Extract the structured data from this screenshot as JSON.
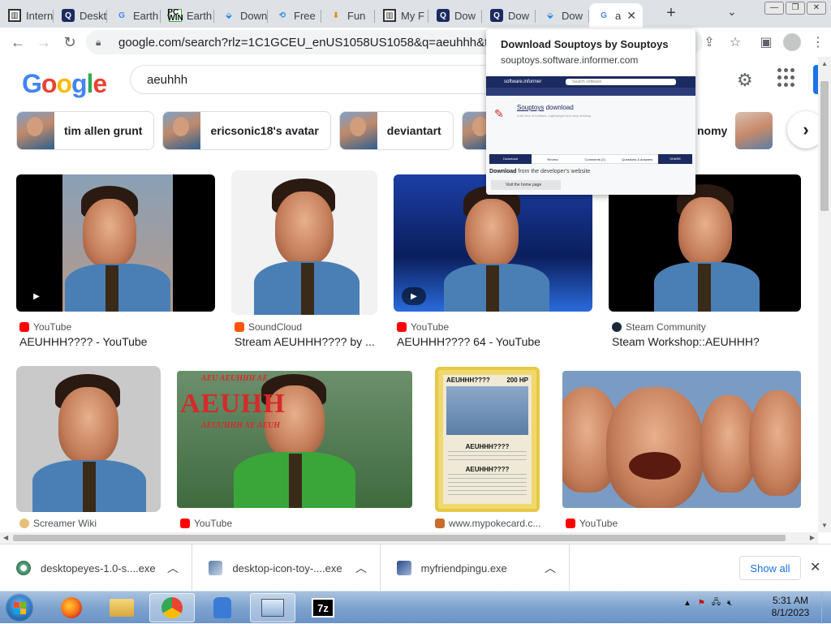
{
  "browser": {
    "tabs": [
      {
        "title": "Internet Archive",
        "icon": "bank-icon"
      },
      {
        "title": "Desktop",
        "icon": "informer-icon"
      },
      {
        "title": "Earth",
        "icon": "google-icon"
      },
      {
        "title": "Earth",
        "icon": "pcwin-icon"
      },
      {
        "title": "Download",
        "icon": "download-icon"
      },
      {
        "title": "Free",
        "icon": "refresh-icon"
      },
      {
        "title": "Fun",
        "icon": "download-arrow-icon"
      },
      {
        "title": "My F",
        "icon": "bank-icon"
      },
      {
        "title": "Dow",
        "icon": "informer-icon"
      },
      {
        "title": "Dow",
        "icon": "informer-icon"
      },
      {
        "title": "Dow",
        "icon": "download-icon"
      },
      {
        "title": "a",
        "icon": "google-icon",
        "active": true
      }
    ],
    "url": "google.com/search?rlz=1C1GCEU_enUS1058US1058&q=aeuhhh&tbm=isch"
  },
  "google": {
    "logo_letters": [
      "G",
      "o",
      "o",
      "g",
      "l",
      "e"
    ],
    "query": "aeuhhh"
  },
  "chips": [
    {
      "label": "tim allen grunt"
    },
    {
      "label": "ericsonic18's avatar"
    },
    {
      "label": "deviantart"
    }
  ],
  "chip_partial": "nomy",
  "results_row1": [
    {
      "source": "YouTube",
      "title": "AEUHHH???? - YouTube"
    },
    {
      "source": "SoundCloud",
      "title": "Stream AEUHHH???? by ..."
    },
    {
      "source": "YouTube",
      "title": "AEUHHH???? 64 - YouTube"
    },
    {
      "source": "Steam Community",
      "title": "Steam Workshop::AEUHHH?"
    }
  ],
  "results_row2": [
    {
      "source": "Screamer Wiki"
    },
    {
      "source": "YouTube"
    },
    {
      "source": "www.mypokecard.c..."
    },
    {
      "source": "YouTube"
    }
  ],
  "meme": {
    "line1": "AEU AEUHHH AE",
    "line2": "AEUHH",
    "line3": "AEUUHHH AE AEUH"
  },
  "pokecard": {
    "name": "AEUHHH????",
    "hp": "200 HP",
    "attack1": "AEUHHH????",
    "attack2": "AEUHHH????"
  },
  "popup": {
    "title": "Download Souptoys by Souptoys",
    "domain": "souptoys.software.informer.com",
    "site_logo": "software.informer",
    "search_placeholder": "Search software",
    "product_name": "Souptoys",
    "product_suffix": " download",
    "product_desc": "A lite free of toolbars. Lightweight and sexy desktop.",
    "tabs": [
      "Download",
      "Review",
      "Comments (2)",
      "Questions & Answers",
      "SHARE"
    ],
    "download_bold": "Download",
    "download_rest": " from the developer's website",
    "visit": "Visit the home page"
  },
  "downloads": [
    {
      "name": "desktopeyes-1.0-s....exe"
    },
    {
      "name": "desktop-icon-toy-....exe"
    },
    {
      "name": "myfriendpingu.exe"
    }
  ],
  "shelf": {
    "show_all": "Show all"
  },
  "taskbar": {
    "time": "5:31 AM",
    "date": "8/1/2023"
  },
  "colors": {
    "accent": "#1a73e8",
    "youtube": "#ff0000",
    "soundcloud": "#ff5500",
    "meme_red": "#d62a2a"
  }
}
